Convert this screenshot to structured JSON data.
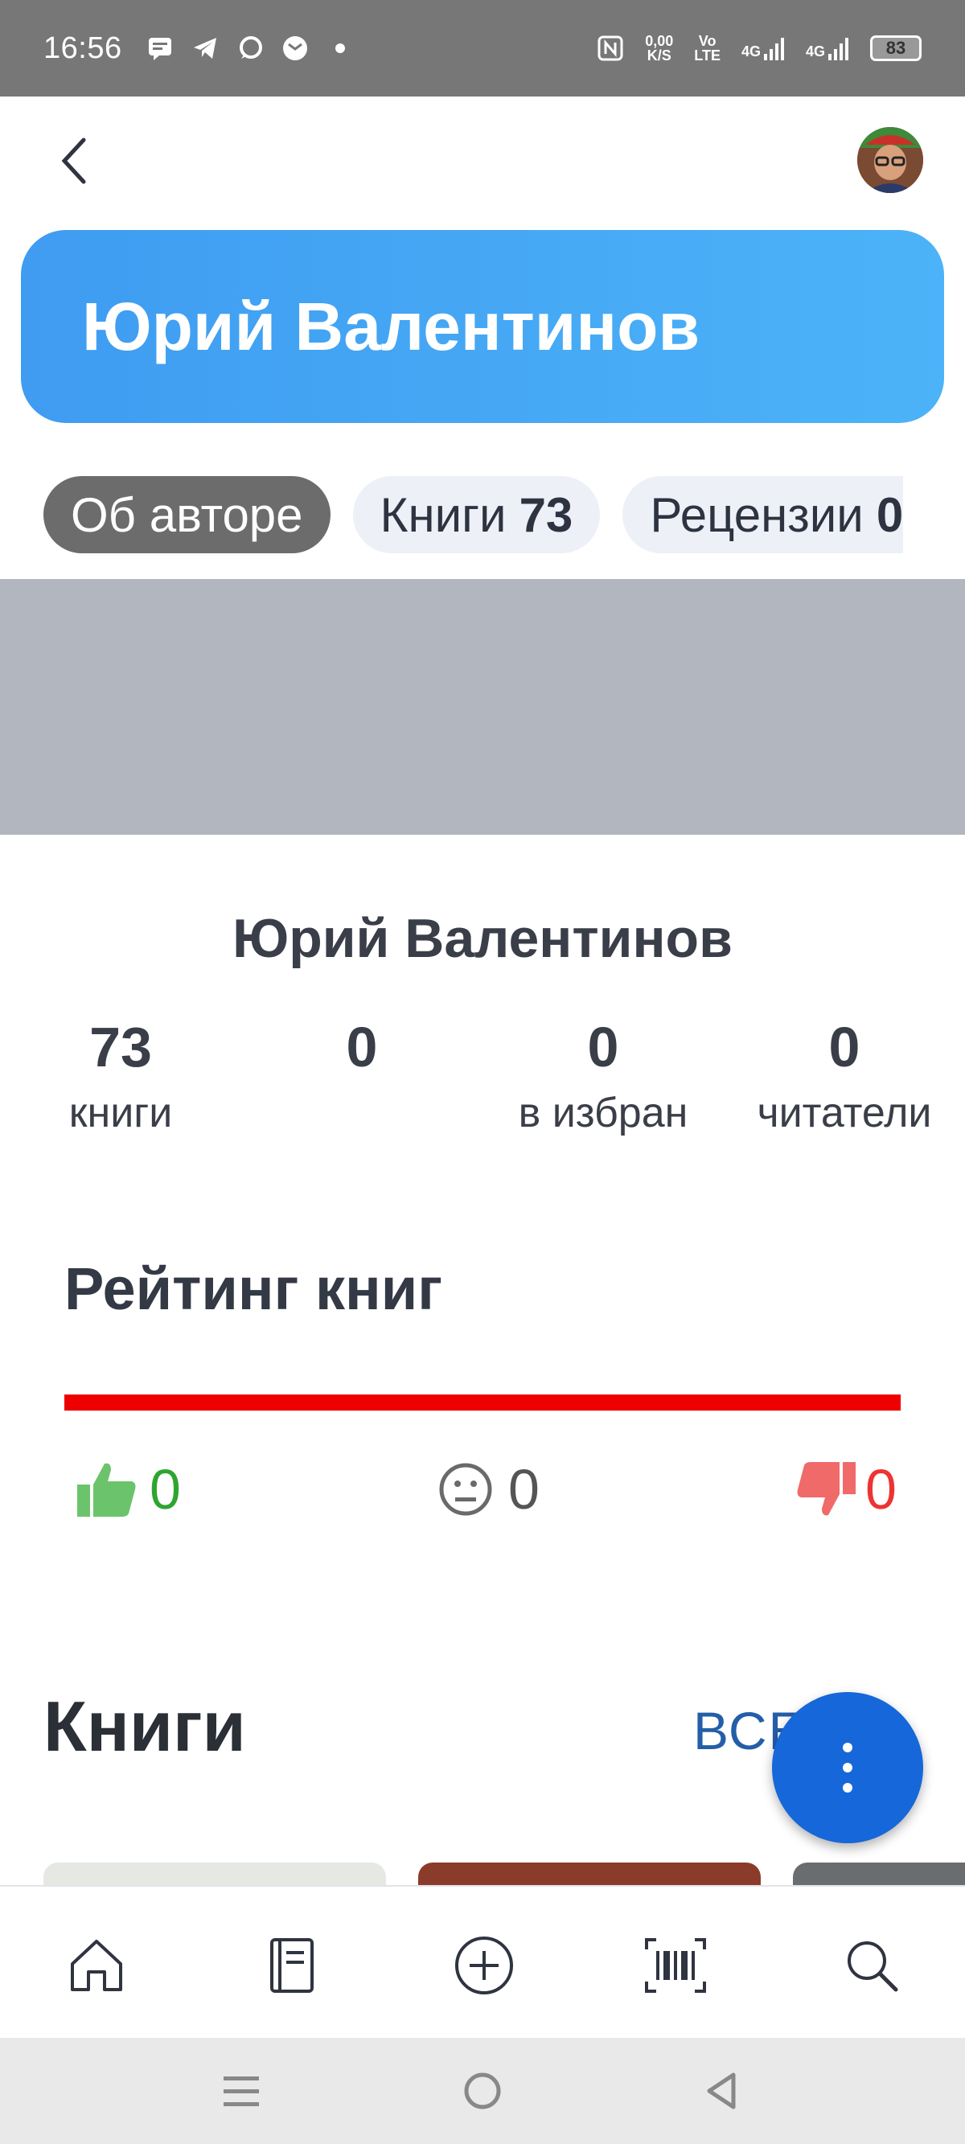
{
  "status_bar": {
    "time": "16:56",
    "speed_value": "0,00",
    "speed_unit": "K/S",
    "volte_top": "Vo",
    "volte_bottom": "LTE",
    "net1": "4G",
    "net2": "4G",
    "battery": "83",
    "icons": [
      "message-icon",
      "telegram-icon",
      "chat-icon",
      "mail-icon",
      "dot-icon",
      "nfc-icon",
      "signal-icon",
      "battery-icon"
    ]
  },
  "header": {
    "title": "Юрий Валентинов"
  },
  "tabs": [
    {
      "label": "Об авторе",
      "count": ""
    },
    {
      "label": "Книги",
      "count": "73"
    },
    {
      "label": "Рецензии",
      "count": "0"
    }
  ],
  "author": {
    "name": "Юрий Валентинов",
    "stats": [
      {
        "value": "73",
        "label": "книги"
      },
      {
        "value": "0",
        "label": ""
      },
      {
        "value": "0",
        "label": "в избран"
      },
      {
        "value": "0",
        "label": "читатели"
      }
    ]
  },
  "rating": {
    "title": "Рейтинг книг",
    "bar_color": "#ee0000",
    "likes": "0",
    "neutral": "0",
    "dislikes": "0",
    "like_color": "#2fa52f",
    "neutral_color": "#555555",
    "dislike_color": "#ee3333"
  },
  "books": {
    "title": "Книги",
    "all_link": "ВСЕ 73"
  },
  "bottom_nav": [
    "home-icon",
    "book-icon",
    "add-icon",
    "barcode-icon",
    "search-icon"
  ],
  "system_nav": [
    "menu-icon",
    "home-circle-icon",
    "back-triangle-icon"
  ],
  "colors": {
    "banner": "#4aaaf5",
    "accent": "#1667d9",
    "link": "#245ea8"
  }
}
